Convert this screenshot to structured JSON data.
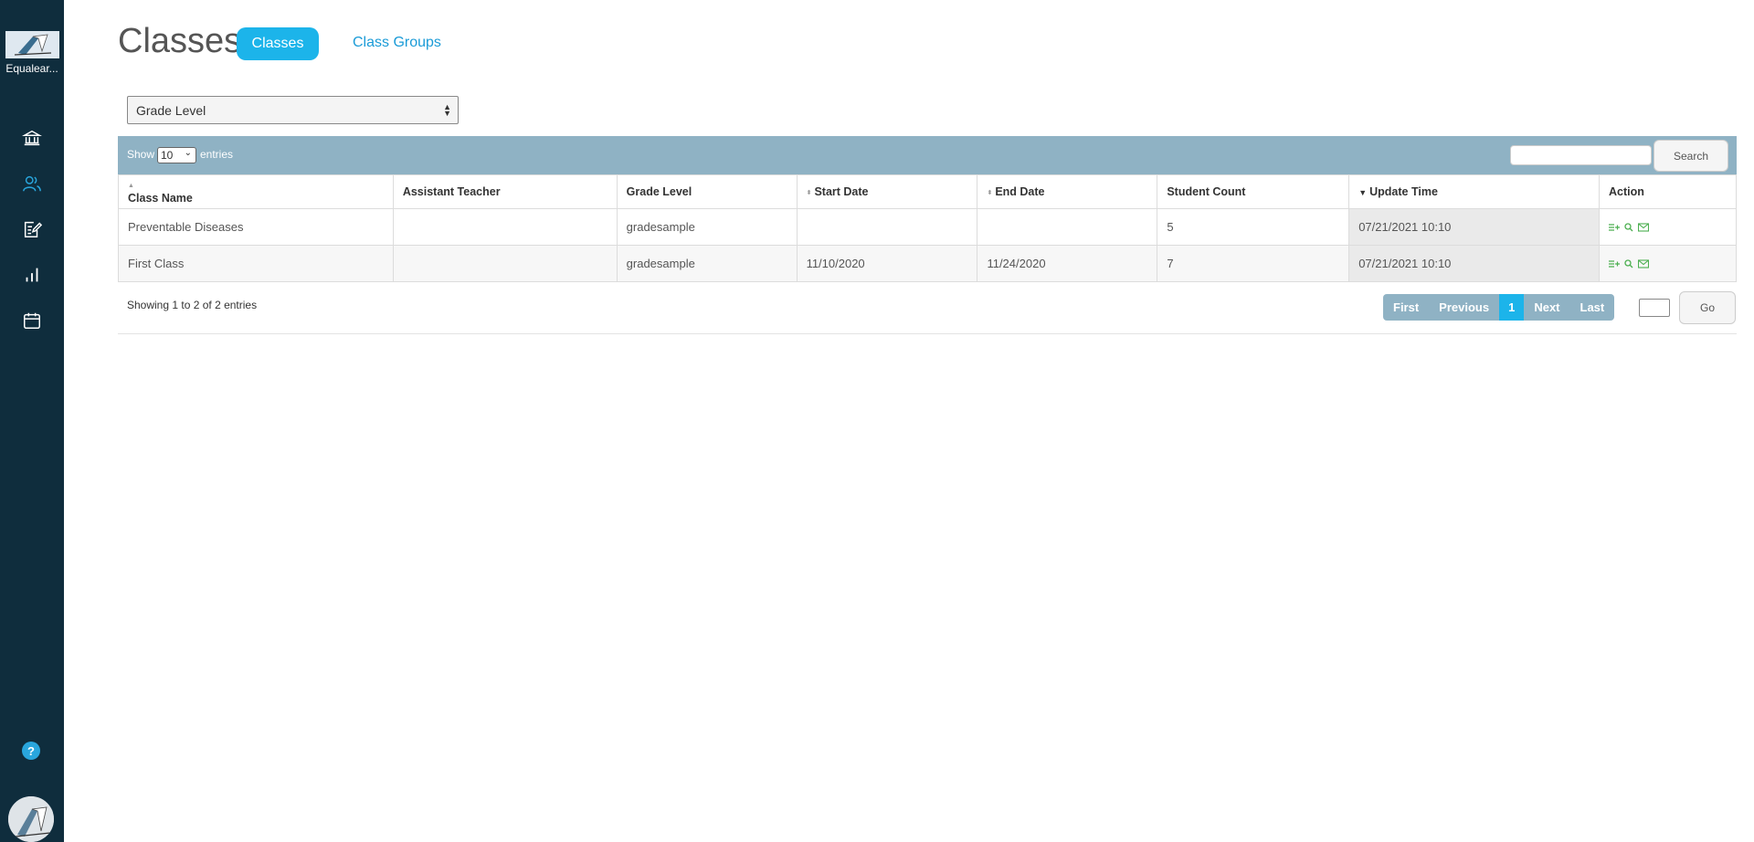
{
  "sidebar": {
    "org_name": "Equalear...",
    "nav": [
      {
        "icon": "institution-icon",
        "active": false
      },
      {
        "icon": "users-icon",
        "active": true
      },
      {
        "icon": "assignment-icon",
        "active": false
      },
      {
        "icon": "bar-chart-icon",
        "active": false
      },
      {
        "icon": "calendar-icon",
        "active": false
      }
    ],
    "help": "?"
  },
  "header": {
    "title": "Classes",
    "tabs": [
      {
        "label": "Classes",
        "active": true
      },
      {
        "label": "Class Groups",
        "active": false
      }
    ]
  },
  "filter": {
    "selected": "Grade Level"
  },
  "toolbar": {
    "show_label": "Show",
    "page_length": "10",
    "entries_label": "entries",
    "search_value": "",
    "search_label": "Search"
  },
  "table": {
    "columns": [
      {
        "label": "Class Name",
        "sort": "sortable"
      },
      {
        "label": "Assistant Teacher",
        "sort": "none"
      },
      {
        "label": "Grade Level",
        "sort": "none"
      },
      {
        "label": "Start Date",
        "sort": "sortable"
      },
      {
        "label": "End Date",
        "sort": "sortable"
      },
      {
        "label": "Student Count",
        "sort": "none"
      },
      {
        "label": "Update Time",
        "sort": "desc"
      },
      {
        "label": "Action",
        "sort": "none"
      }
    ],
    "rows": [
      {
        "class_name": "Preventable Diseases",
        "assistant_teacher": "",
        "grade_level": "gradesample",
        "start_date": "",
        "end_date": "",
        "student_count": "5",
        "update_time": "07/21/2021 10:10"
      },
      {
        "class_name": "First Class",
        "assistant_teacher": "",
        "grade_level": "gradesample",
        "start_date": "11/10/2020",
        "end_date": "11/24/2020",
        "student_count": "7",
        "update_time": "07/21/2021 10:10"
      }
    ],
    "actions": [
      "add-list-icon",
      "search-icon",
      "mail-icon"
    ]
  },
  "footer": {
    "info": "Showing 1 to 2 of 2 entries",
    "pager": {
      "first": "First",
      "previous": "Previous",
      "current": "1",
      "next": "Next",
      "last": "Last"
    },
    "goto_value": "",
    "go_label": "Go"
  },
  "colors": {
    "sidebar_bg": "#0f2d3d",
    "accent": "#1cb4ea",
    "link": "#1a9bd7",
    "toolbar_bg": "#8fb2c4",
    "action_icon": "#4caf50"
  }
}
